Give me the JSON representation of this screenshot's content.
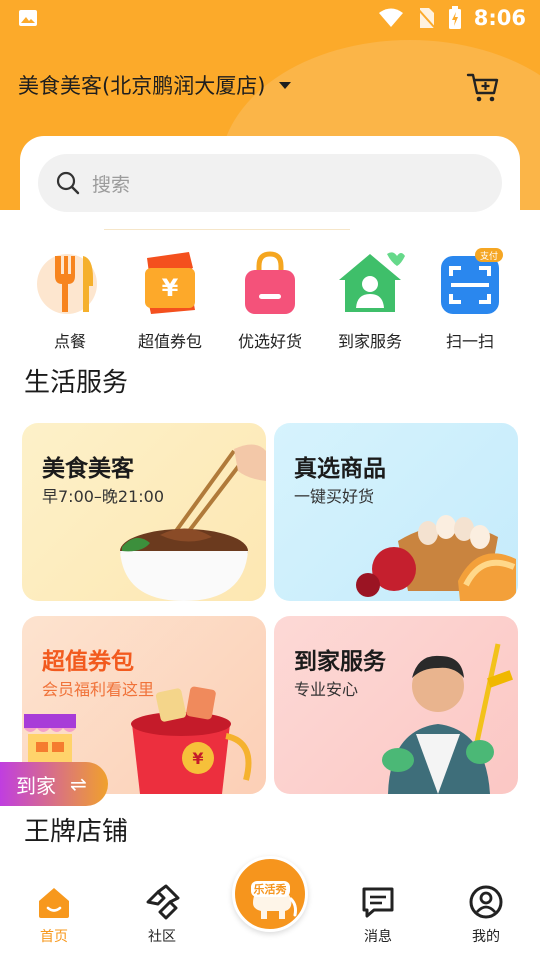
{
  "status_bar": {
    "time": "8:06"
  },
  "header": {
    "store_name": "美食美客(北京鹏润大厦店)"
  },
  "search": {
    "placeholder": "搜索"
  },
  "quick_entries": [
    {
      "label": "点餐"
    },
    {
      "label": "超值券包"
    },
    {
      "label": "优选好货"
    },
    {
      "label": "到家服务"
    },
    {
      "label": "扫一扫",
      "badge": "支付"
    }
  ],
  "sections": {
    "life_services": "生活服务",
    "brand_stores": "王牌店铺"
  },
  "service_cards": [
    {
      "title": "美食美客",
      "subtitle": "早7:00–晚21:00"
    },
    {
      "title": "真选商品",
      "subtitle": "一键买好货"
    },
    {
      "title": "超值券包",
      "subtitle": "会员福利看这里"
    },
    {
      "title": "到家服务",
      "subtitle": "专业安心"
    }
  ],
  "float_badge": {
    "label": "到家",
    "arrow": "⇌"
  },
  "bottom_nav": {
    "items": [
      {
        "label": "首页"
      },
      {
        "label": "社区"
      },
      {
        "label": "消息"
      },
      {
        "label": "我的"
      }
    ],
    "center_logo_text": "乐活秀"
  },
  "colors": {
    "brand_orange": "#fcaa2a",
    "accent": "#f7981d",
    "coupon_red": "#f25a1e"
  }
}
